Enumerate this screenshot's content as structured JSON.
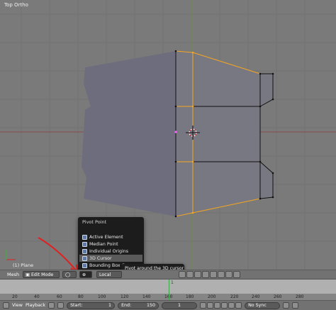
{
  "viewport": {
    "label": "Top Ortho",
    "object_label": "(1) Plane"
  },
  "pivot_menu": {
    "title": "Pivot Point",
    "items": [
      {
        "label": "Active Element",
        "icon": "active-element-icon"
      },
      {
        "label": "Median Point",
        "icon": "median-point-icon"
      },
      {
        "label": "Individual Origins",
        "icon": "individual-origins-icon"
      },
      {
        "label": "3D Cursor",
        "icon": "3d-cursor-icon",
        "active": true
      },
      {
        "label": "Bounding Box C",
        "icon": "bounding-box-icon"
      }
    ],
    "tooltip": "Pivot around the 3D cursor"
  },
  "header_bar": {
    "mesh_label": "Mesh",
    "mode": "Edit Mode",
    "orientation": "Local"
  },
  "timeline": {
    "ticks": [
      "20",
      "40",
      "60",
      "80",
      "100",
      "120",
      "140",
      "160",
      "180",
      "200",
      "220",
      "240",
      "260",
      "280"
    ],
    "current_frame": "1"
  },
  "playback": {
    "view_label": "View",
    "playback_label": "Playback",
    "start_label": "Start:",
    "start_value": "1",
    "end_label": "End:",
    "end_value": "150",
    "current": "1",
    "sync": "No Sync"
  },
  "colors": {
    "mesh_fill": "#6f6f80",
    "edge_selected": "#f5a623",
    "edge": "#000000",
    "annotation_arrow": "#e02020"
  }
}
